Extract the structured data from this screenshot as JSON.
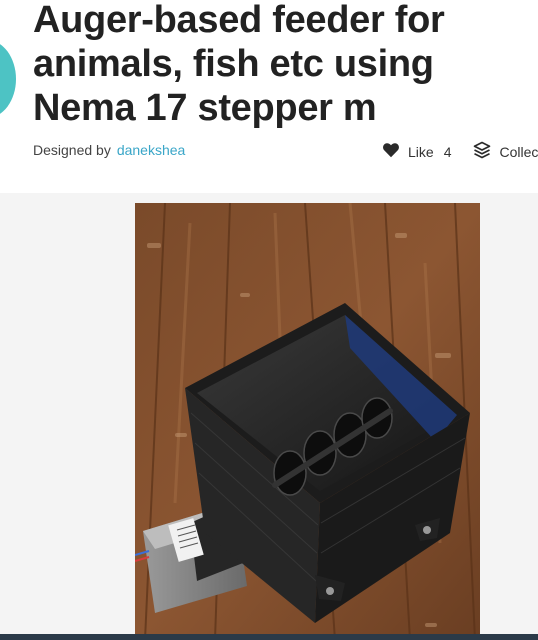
{
  "thing": {
    "title": "Auger-based feeder for animals, fish etc using Nema 17 stepper m",
    "designed_by_label": "Designed by",
    "designer": "danekshea"
  },
  "actions": {
    "like_label": "Like",
    "like_count": "4",
    "collect_label": "Collec"
  },
  "icons": {
    "like": "heart-icon",
    "collect": "layers-icon"
  },
  "colors": {
    "avatar": "#4dc3c4",
    "link": "#3aa6c8",
    "title": "#222222"
  }
}
